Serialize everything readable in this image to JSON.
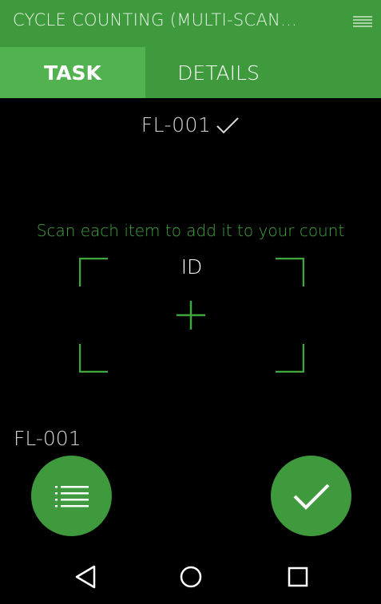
{
  "appbar": {
    "title": "CYCLE COUNTING (MULTI-SCAN...",
    "menu_icon": "hamburger-menu-icon"
  },
  "tabs": [
    {
      "label": "TASK",
      "selected": true
    },
    {
      "label": "DETAILS",
      "selected": false
    }
  ],
  "scanned": {
    "id": "FL-001",
    "status_icon": "checkmark-icon"
  },
  "scanner": {
    "instruction": "Scan each item to add it to your count",
    "label": "ID",
    "reticle_icon": "plus-icon"
  },
  "last_scan": {
    "value": "FL-001"
  },
  "actions": {
    "list_icon": "list-icon",
    "confirm_icon": "checkmark-icon"
  },
  "system_nav": {
    "back_icon": "back-triangle-icon",
    "home_icon": "home-circle-icon",
    "recents_icon": "recents-square-icon"
  },
  "colors": {
    "primary": "#3e9a3d",
    "tab_selected": "#52b24f",
    "accent_text": "#3fa83d",
    "background": "#000000"
  }
}
